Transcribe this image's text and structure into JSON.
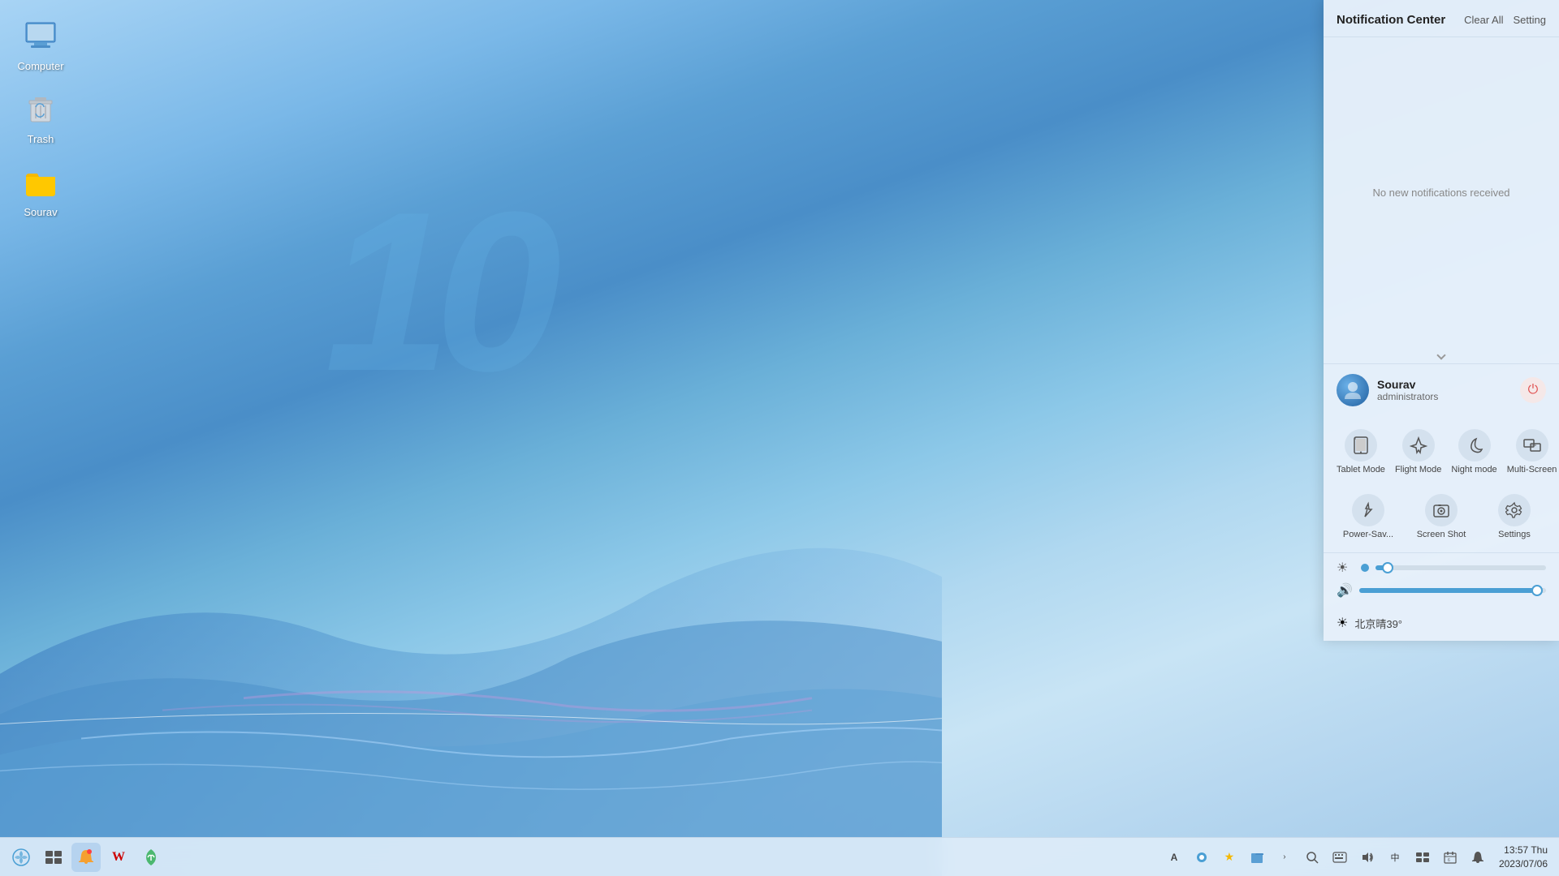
{
  "desktop": {
    "icons": [
      {
        "id": "computer",
        "label": "Computer",
        "type": "computer"
      },
      {
        "id": "trash",
        "label": "Trash",
        "type": "trash"
      },
      {
        "id": "sourav",
        "label": "Sourav",
        "type": "folder"
      }
    ],
    "watermark": "10"
  },
  "taskbar": {
    "left_icons": [
      {
        "id": "start",
        "symbol": "🌀",
        "label": "Start Menu"
      },
      {
        "id": "multitask",
        "symbol": "⬛",
        "label": "Multitasking"
      },
      {
        "id": "notification2",
        "symbol": "🔔",
        "label": "Notification"
      },
      {
        "id": "wps",
        "symbol": "W",
        "label": "WPS"
      },
      {
        "id": "store",
        "symbol": "🍃",
        "label": "App Store"
      }
    ],
    "right_icons": [
      {
        "id": "assistant",
        "symbol": "A",
        "label": "Assistant"
      },
      {
        "id": "indicator",
        "symbol": "●",
        "label": "Indicator"
      },
      {
        "id": "star",
        "symbol": "★",
        "label": "Star"
      },
      {
        "id": "files",
        "symbol": "📁",
        "label": "Files"
      },
      {
        "id": "arrow",
        "symbol": "›",
        "label": "Expand"
      },
      {
        "id": "search",
        "symbol": "🔍",
        "label": "Search"
      },
      {
        "id": "keyboard2",
        "symbol": "⌨",
        "label": "Keyboard"
      },
      {
        "id": "volume",
        "symbol": "🔊",
        "label": "Volume"
      },
      {
        "id": "keyboard3",
        "symbol": "⌨",
        "label": "Input Method"
      },
      {
        "id": "taskview",
        "symbol": "⊞",
        "label": "Task View"
      },
      {
        "id": "calendar",
        "symbol": "📅",
        "label": "Calendar"
      },
      {
        "id": "notif_bell",
        "symbol": "🔔",
        "label": "Notification Bell"
      }
    ],
    "clock": {
      "time": "13:57 Thu",
      "date": "2023/07/06"
    }
  },
  "notification_panel": {
    "title": "Notification Center",
    "clear_all_label": "Clear All",
    "setting_label": "Setting",
    "empty_message": "No new notifications received",
    "user": {
      "name": "Sourav",
      "role": "administrators"
    },
    "quick_actions_row1": [
      {
        "id": "tablet",
        "label": "Tablet Mode",
        "symbol": "⊡"
      },
      {
        "id": "flight",
        "label": "Flight Mode",
        "symbol": "✈"
      },
      {
        "id": "night",
        "label": "Night mode",
        "symbol": "🌙"
      },
      {
        "id": "multiscreen",
        "label": "Multi-Screen",
        "symbol": "▶"
      }
    ],
    "quick_actions_row2": [
      {
        "id": "powersave",
        "label": "Power-Sav...",
        "symbol": "💧"
      },
      {
        "id": "screenshot",
        "label": "Screen Shot",
        "symbol": "📷"
      },
      {
        "id": "settings",
        "label": "Settings",
        "symbol": "⚙"
      }
    ],
    "brightness": {
      "icon": "☀",
      "value_percent": 7
    },
    "volume": {
      "icon": "🔊",
      "value_percent": 95
    },
    "weather": {
      "icon": "☀",
      "text": "北京晴39°"
    }
  }
}
